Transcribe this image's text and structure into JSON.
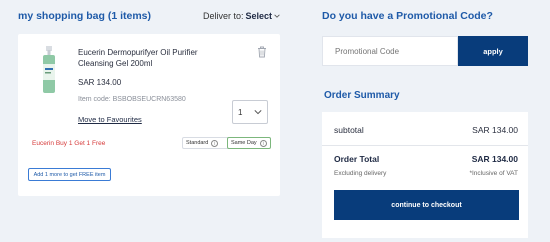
{
  "bag": {
    "title": "my shopping bag (1 items)",
    "deliver_label": "Deliver to:",
    "deliver_value": "Select"
  },
  "item": {
    "name": "Eucerin Dermopurifyer Oil Purifier Cleansing Gel 200ml",
    "price": "SAR  134.00",
    "item_code": "Item code: BSBOBSEUCRN63580",
    "move_to_favourites": "Move to Favourites",
    "quantity": "1",
    "promo_offer": "Eucerin Buy 1 Get 1 Free",
    "shipping_standard": "Standard",
    "shipping_sameday": "Same Day",
    "add_more_button": "Add 1 more to get FREE item"
  },
  "promo": {
    "title": "Do you have a Promotional Code?",
    "placeholder": "Promotional Code",
    "apply_label": "apply"
  },
  "summary": {
    "title": "Order Summary",
    "subtotal_label": "subtotal",
    "subtotal_value": "SAR 134.00",
    "total_label": "Order Total",
    "total_value": "SAR 134.00",
    "excl_delivery": "Excluding delivery",
    "vat_note": "*Inclusive of VAT",
    "checkout_label": "continue to checkout"
  },
  "colors": {
    "accent_blue": "#1e5aa8",
    "button_navy": "#083c7b",
    "promo_red": "#d63a3a",
    "background": "#eef2f7"
  }
}
